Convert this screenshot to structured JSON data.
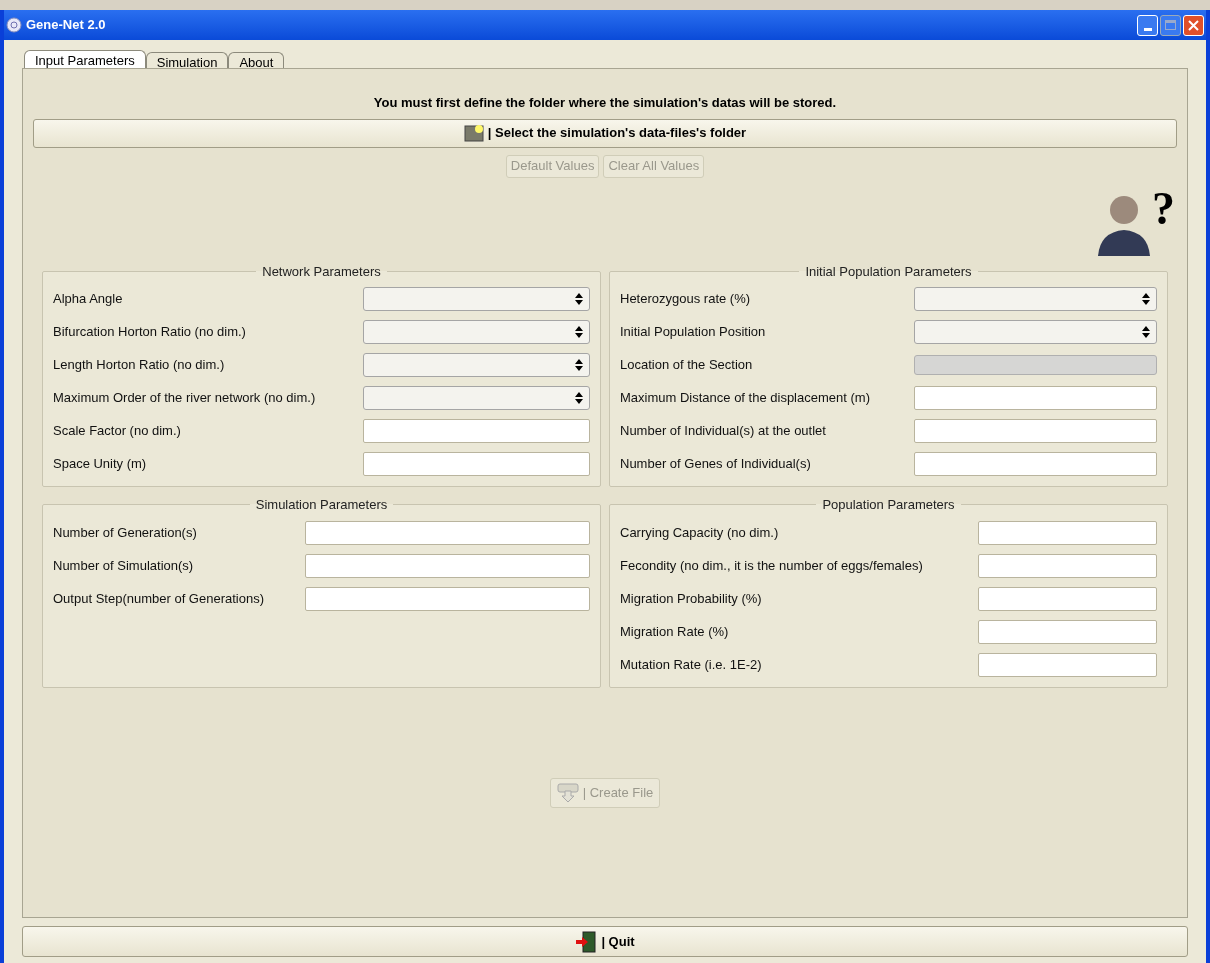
{
  "window": {
    "title": "Gene-Net 2.0"
  },
  "tabs": [
    {
      "label": "Input Parameters",
      "selected": true
    },
    {
      "label": "Simulation",
      "selected": false
    },
    {
      "label": "About",
      "selected": false
    }
  ],
  "notice": "You must first define the folder where the simulation's datas will be stored.",
  "folder_button": {
    "label": "| Select the simulation's data-files's folder",
    "disabled": false
  },
  "value_buttons": [
    {
      "label": "Default Values",
      "disabled": true
    },
    {
      "label": "Clear All Values",
      "disabled": true
    }
  ],
  "help": {
    "mark": "?"
  },
  "groups": [
    {
      "title": "Network Parameters",
      "fields": [
        {
          "label": "Alpha Angle",
          "kind": "select"
        },
        {
          "label": "Bifurcation Horton Ratio (no dim.)",
          "kind": "select"
        },
        {
          "label": "Length Horton Ratio (no dim.)",
          "kind": "select"
        },
        {
          "label": "Maximum Order of the river network (no dim.)",
          "kind": "select"
        },
        {
          "label": "Scale Factor (no dim.)",
          "kind": "text"
        },
        {
          "label": "Space Unity (m)",
          "kind": "text"
        }
      ]
    },
    {
      "title": "Initial Population Parameters",
      "fields": [
        {
          "label": "Heterozygous rate (%)",
          "kind": "select"
        },
        {
          "label": "Initial Population Position",
          "kind": "select"
        },
        {
          "label": "Location of the Section",
          "kind": "readonly"
        },
        {
          "label": "Maximum Distance of the displacement (m)",
          "kind": "text"
        },
        {
          "label": "Number of Individual(s) at the outlet",
          "kind": "text"
        },
        {
          "label": "Number of Genes of Individual(s)",
          "kind": "text"
        }
      ]
    },
    {
      "title": "Simulation Parameters",
      "fields": [
        {
          "label": "Number of Generation(s)",
          "kind": "text"
        },
        {
          "label": "Number of Simulation(s)",
          "kind": "text"
        },
        {
          "label": "Output Step(number of Generations)",
          "kind": "text"
        }
      ]
    },
    {
      "title": "Population Parameters",
      "fields": [
        {
          "label": "Carrying Capacity (no dim.)",
          "kind": "text"
        },
        {
          "label": "Fecondity (no dim., it is the number of eggs/females)",
          "kind": "text"
        },
        {
          "label": "Migration Probability (%)",
          "kind": "text"
        },
        {
          "label": "Migration Rate (%)",
          "kind": "text"
        },
        {
          "label": "Mutation Rate (i.e. 1E-2)",
          "kind": "text"
        }
      ]
    }
  ],
  "create_button": {
    "label": "| Create File",
    "disabled": true
  },
  "quit_button": {
    "label": "| Quit",
    "disabled": false
  }
}
